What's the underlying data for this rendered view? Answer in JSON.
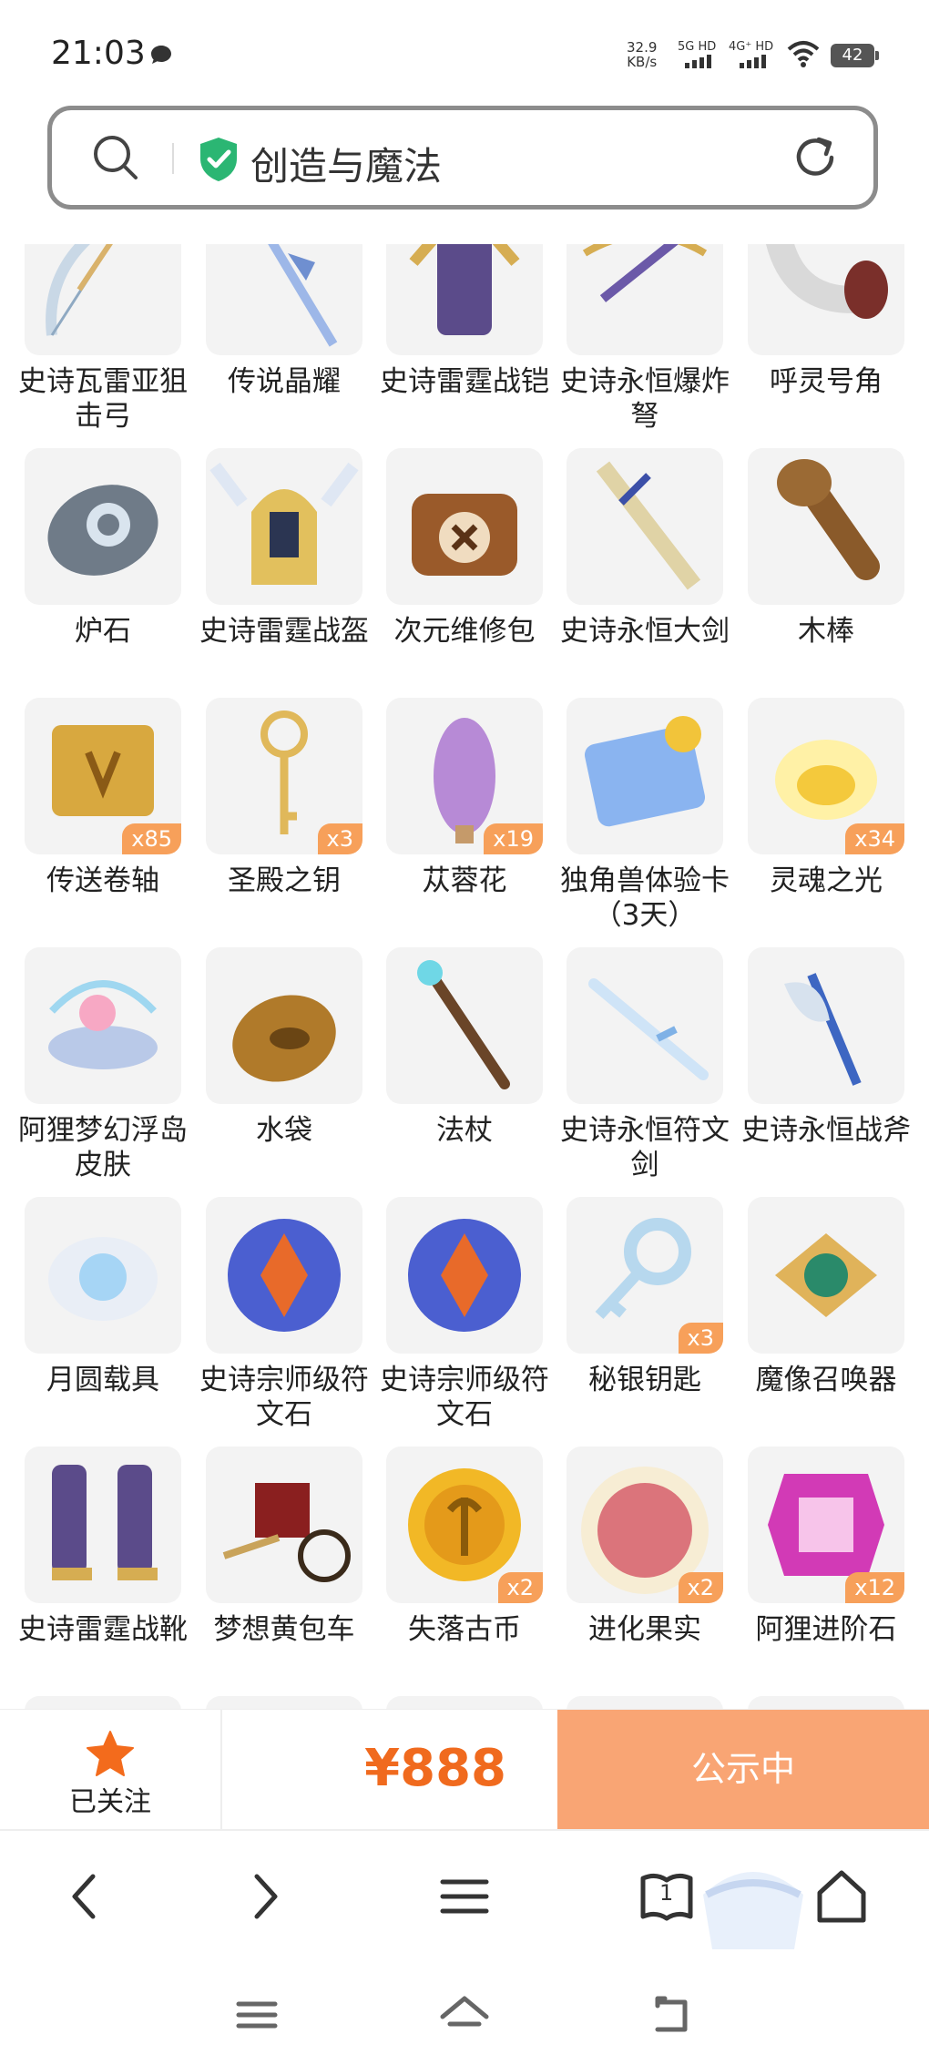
{
  "status_bar": {
    "time": "21:03",
    "net_speed_value": "32.9",
    "net_speed_unit": "KB/s",
    "signal_1": "5G HD",
    "signal_2": "4G⁺ HD",
    "battery": "42"
  },
  "address_bar": {
    "title": "创造与魔法",
    "secure_color": "#2bb673"
  },
  "items": [
    {
      "name": "史诗瓦雷亚狙击弓",
      "icon": "bow-icon",
      "qty": ""
    },
    {
      "name": "传说晶耀",
      "icon": "crystal-spear-icon",
      "qty": ""
    },
    {
      "name": "史诗雷霆战铠",
      "icon": "armor-icon",
      "qty": ""
    },
    {
      "name": "史诗永恒爆炸弩",
      "icon": "crossbow-icon",
      "qty": ""
    },
    {
      "name": "呼灵号角",
      "icon": "horn-icon",
      "qty": ""
    },
    {
      "name": "炉石",
      "icon": "hearthstone-icon",
      "qty": ""
    },
    {
      "name": "史诗雷霆战盔",
      "icon": "helmet-icon",
      "qty": ""
    },
    {
      "name": "次元维修包",
      "icon": "repair-kit-icon",
      "qty": ""
    },
    {
      "name": "史诗永恒大剑",
      "icon": "greatsword-icon",
      "qty": ""
    },
    {
      "name": "木棒",
      "icon": "wooden-club-icon",
      "qty": ""
    },
    {
      "name": "传送卷轴",
      "icon": "scroll-icon",
      "qty": "x85"
    },
    {
      "name": "圣殿之钥",
      "icon": "temple-key-icon",
      "qty": "x3"
    },
    {
      "name": "苁蓉花",
      "icon": "cistanche-flower-icon",
      "qty": "x19"
    },
    {
      "name": "独角兽体验卡（3天）",
      "icon": "unicorn-card-icon",
      "qty": ""
    },
    {
      "name": "灵魂之光",
      "icon": "soul-light-icon",
      "qty": "x34"
    },
    {
      "name": "阿狸梦幻浮岛皮肤",
      "icon": "floating-island-icon",
      "qty": ""
    },
    {
      "name": "水袋",
      "icon": "water-bag-icon",
      "qty": ""
    },
    {
      "name": "法杖",
      "icon": "staff-icon",
      "qty": ""
    },
    {
      "name": "史诗永恒符文剑",
      "icon": "rune-sword-icon",
      "qty": ""
    },
    {
      "name": "史诗永恒战斧",
      "icon": "battle-axe-icon",
      "qty": ""
    },
    {
      "name": "月圆载具",
      "icon": "moon-mount-icon",
      "qty": ""
    },
    {
      "name": "史诗宗师级符文石",
      "icon": "rune-stone-icon",
      "qty": ""
    },
    {
      "name": "史诗宗师级符文石",
      "icon": "rune-stone-icon",
      "qty": ""
    },
    {
      "name": "秘银钥匙",
      "icon": "mithril-key-icon",
      "qty": "x3"
    },
    {
      "name": "魔像召唤器",
      "icon": "golem-summoner-icon",
      "qty": ""
    },
    {
      "name": "史诗雷霆战靴",
      "icon": "boots-icon",
      "qty": ""
    },
    {
      "name": "梦想黄包车",
      "icon": "rickshaw-icon",
      "qty": ""
    },
    {
      "name": "失落古币",
      "icon": "ancient-coin-icon",
      "qty": "x2"
    },
    {
      "name": "进化果实",
      "icon": "evolution-fruit-icon",
      "qty": "x2"
    },
    {
      "name": "阿狸进阶石",
      "icon": "advance-stone-icon",
      "qty": "x12"
    }
  ],
  "action_bar": {
    "follow_label": "已关注",
    "price": "¥888",
    "status_button": "公示中",
    "accent": "#f06a1e",
    "button_color": "#f9a574"
  },
  "browser_nav": {
    "tab_count": "1"
  }
}
